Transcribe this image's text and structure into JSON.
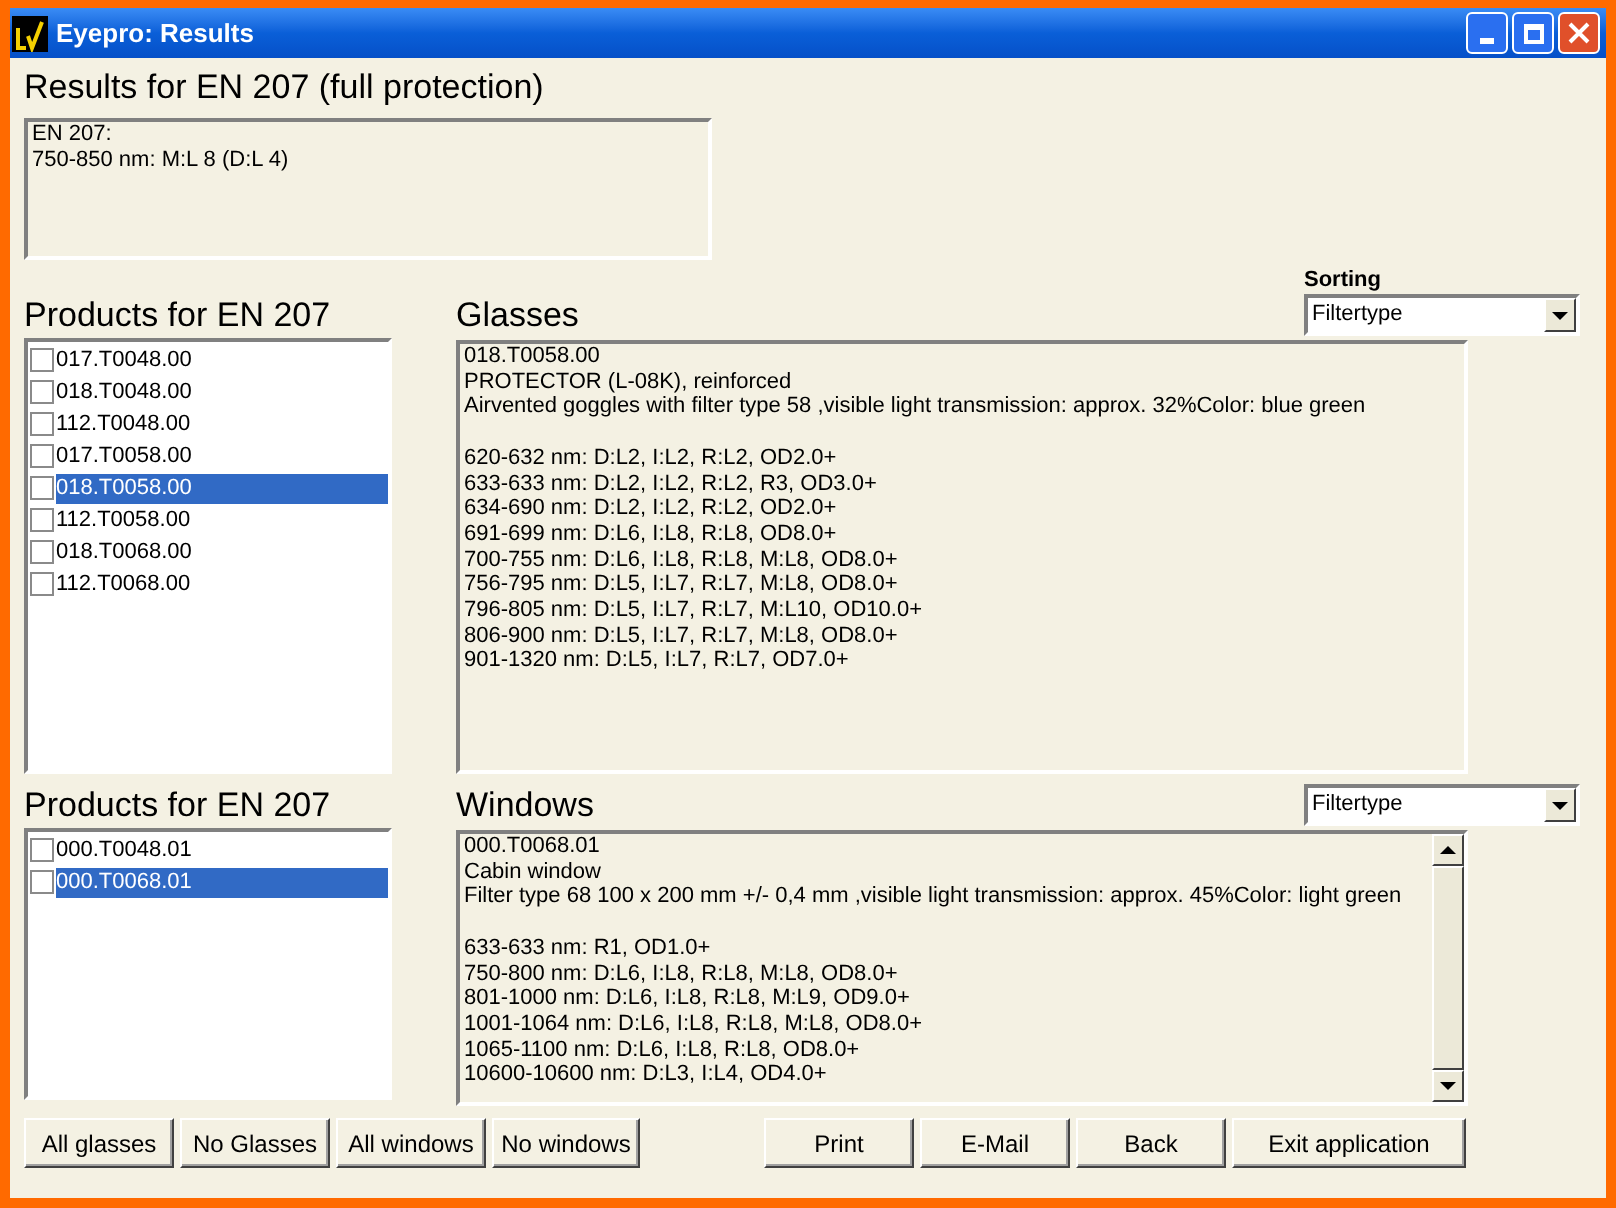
{
  "window": {
    "title": "Eyepro: Results"
  },
  "results": {
    "heading": "Results for EN 207 (full protection)",
    "lines": [
      "EN 207:",
      "750-850 nm: M:L 8 (D:L 4)"
    ]
  },
  "sorting": {
    "label": "Sorting"
  },
  "sections": [
    {
      "products_heading": "Products for EN 207",
      "detail_heading": "Glasses",
      "dropdown": {
        "value": "Filtertype"
      },
      "scrollbar": false,
      "products": [
        {
          "label": "017.T0048.00",
          "checked": false,
          "selected": false
        },
        {
          "label": "018.T0048.00",
          "checked": false,
          "selected": false
        },
        {
          "label": "112.T0048.00",
          "checked": false,
          "selected": false
        },
        {
          "label": "017.T0058.00",
          "checked": false,
          "selected": false
        },
        {
          "label": "018.T0058.00",
          "checked": false,
          "selected": true
        },
        {
          "label": "112.T0058.00",
          "checked": false,
          "selected": false
        },
        {
          "label": "018.T0068.00",
          "checked": false,
          "selected": false
        },
        {
          "label": "112.T0068.00",
          "checked": false,
          "selected": false
        }
      ],
      "description": [
        "018.T0058.00",
        "PROTECTOR (L-08K), reinforced",
        "Airvented goggles with filter type 58 ,visible light transmission: approx. 32%Color: blue green"
      ],
      "specs": [
        "620-632 nm: D:L2, I:L2, R:L2, OD2.0+",
        "633-633 nm: D:L2, I:L2, R:L2, R3, OD3.0+",
        "634-690 nm: D:L2, I:L2, R:L2, OD2.0+",
        "691-699 nm: D:L6, I:L8, R:L8, OD8.0+",
        "700-755 nm: D:L6, I:L8, R:L8, M:L8, OD8.0+",
        "756-795 nm: D:L5, I:L7, R:L7, M:L8, OD8.0+",
        "796-805 nm: D:L5, I:L7, R:L7, M:L10, OD10.0+",
        "806-900 nm: D:L5, I:L7, R:L7, M:L8, OD8.0+",
        "901-1320 nm: D:L5, I:L7, R:L7, OD7.0+"
      ]
    },
    {
      "products_heading": "Products for EN 207",
      "detail_heading": "Windows",
      "dropdown": {
        "value": "Filtertype"
      },
      "scrollbar": true,
      "products": [
        {
          "label": "000.T0048.01",
          "checked": false,
          "selected": false
        },
        {
          "label": "000.T0068.01",
          "checked": false,
          "selected": true
        }
      ],
      "description": [
        "000.T0068.01",
        "Cabin window",
        "Filter type 68 100 x 200 mm +/- 0,4 mm ,visible light transmission: approx. 45%Color: light green"
      ],
      "specs": [
        "633-633 nm: R1, OD1.0+",
        "750-800 nm: D:L6, I:L8, R:L8, M:L8, OD8.0+",
        "801-1000 nm: D:L6, I:L8, R:L8, M:L9, OD9.0+",
        "1001-1064 nm: D:L6, I:L8, R:L8, M:L8, OD8.0+",
        "1065-1100 nm: D:L6, I:L8, R:L8, OD8.0+",
        "10600-10600 nm: D:L3, I:L4, OD4.0+"
      ]
    }
  ],
  "buttons_left": [
    "All glasses",
    "No Glasses",
    "All windows",
    "No windows"
  ],
  "buttons_right": [
    "Print",
    "E-Mail",
    "Back",
    "Exit application"
  ]
}
